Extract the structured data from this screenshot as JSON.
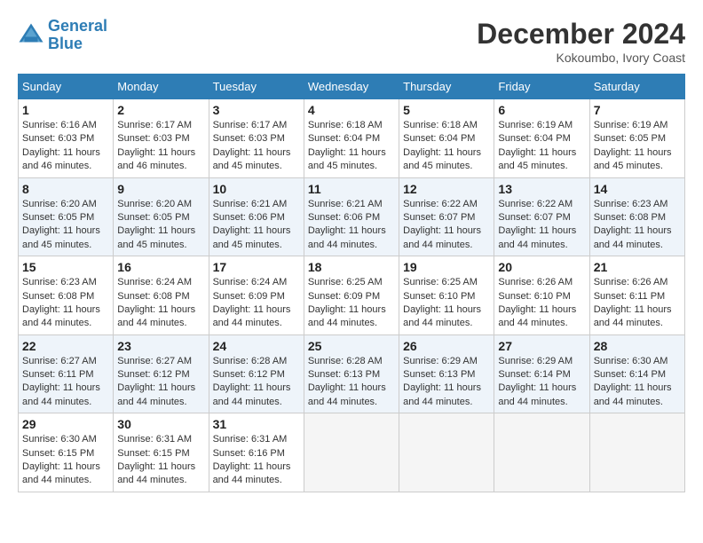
{
  "header": {
    "logo_line1": "General",
    "logo_line2": "Blue",
    "month_title": "December 2024",
    "location": "Kokoumbo, Ivory Coast"
  },
  "weekdays": [
    "Sunday",
    "Monday",
    "Tuesday",
    "Wednesday",
    "Thursday",
    "Friday",
    "Saturday"
  ],
  "weeks": [
    [
      {
        "day": "1",
        "sunrise": "6:16 AM",
        "sunset": "6:03 PM",
        "daylight": "11 hours and 46 minutes."
      },
      {
        "day": "2",
        "sunrise": "6:17 AM",
        "sunset": "6:03 PM",
        "daylight": "11 hours and 46 minutes."
      },
      {
        "day": "3",
        "sunrise": "6:17 AM",
        "sunset": "6:03 PM",
        "daylight": "11 hours and 45 minutes."
      },
      {
        "day": "4",
        "sunrise": "6:18 AM",
        "sunset": "6:04 PM",
        "daylight": "11 hours and 45 minutes."
      },
      {
        "day": "5",
        "sunrise": "6:18 AM",
        "sunset": "6:04 PM",
        "daylight": "11 hours and 45 minutes."
      },
      {
        "day": "6",
        "sunrise": "6:19 AM",
        "sunset": "6:04 PM",
        "daylight": "11 hours and 45 minutes."
      },
      {
        "day": "7",
        "sunrise": "6:19 AM",
        "sunset": "6:05 PM",
        "daylight": "11 hours and 45 minutes."
      }
    ],
    [
      {
        "day": "8",
        "sunrise": "6:20 AM",
        "sunset": "6:05 PM",
        "daylight": "11 hours and 45 minutes."
      },
      {
        "day": "9",
        "sunrise": "6:20 AM",
        "sunset": "6:05 PM",
        "daylight": "11 hours and 45 minutes."
      },
      {
        "day": "10",
        "sunrise": "6:21 AM",
        "sunset": "6:06 PM",
        "daylight": "11 hours and 45 minutes."
      },
      {
        "day": "11",
        "sunrise": "6:21 AM",
        "sunset": "6:06 PM",
        "daylight": "11 hours and 44 minutes."
      },
      {
        "day": "12",
        "sunrise": "6:22 AM",
        "sunset": "6:07 PM",
        "daylight": "11 hours and 44 minutes."
      },
      {
        "day": "13",
        "sunrise": "6:22 AM",
        "sunset": "6:07 PM",
        "daylight": "11 hours and 44 minutes."
      },
      {
        "day": "14",
        "sunrise": "6:23 AM",
        "sunset": "6:08 PM",
        "daylight": "11 hours and 44 minutes."
      }
    ],
    [
      {
        "day": "15",
        "sunrise": "6:23 AM",
        "sunset": "6:08 PM",
        "daylight": "11 hours and 44 minutes."
      },
      {
        "day": "16",
        "sunrise": "6:24 AM",
        "sunset": "6:08 PM",
        "daylight": "11 hours and 44 minutes."
      },
      {
        "day": "17",
        "sunrise": "6:24 AM",
        "sunset": "6:09 PM",
        "daylight": "11 hours and 44 minutes."
      },
      {
        "day": "18",
        "sunrise": "6:25 AM",
        "sunset": "6:09 PM",
        "daylight": "11 hours and 44 minutes."
      },
      {
        "day": "19",
        "sunrise": "6:25 AM",
        "sunset": "6:10 PM",
        "daylight": "11 hours and 44 minutes."
      },
      {
        "day": "20",
        "sunrise": "6:26 AM",
        "sunset": "6:10 PM",
        "daylight": "11 hours and 44 minutes."
      },
      {
        "day": "21",
        "sunrise": "6:26 AM",
        "sunset": "6:11 PM",
        "daylight": "11 hours and 44 minutes."
      }
    ],
    [
      {
        "day": "22",
        "sunrise": "6:27 AM",
        "sunset": "6:11 PM",
        "daylight": "11 hours and 44 minutes."
      },
      {
        "day": "23",
        "sunrise": "6:27 AM",
        "sunset": "6:12 PM",
        "daylight": "11 hours and 44 minutes."
      },
      {
        "day": "24",
        "sunrise": "6:28 AM",
        "sunset": "6:12 PM",
        "daylight": "11 hours and 44 minutes."
      },
      {
        "day": "25",
        "sunrise": "6:28 AM",
        "sunset": "6:13 PM",
        "daylight": "11 hours and 44 minutes."
      },
      {
        "day": "26",
        "sunrise": "6:29 AM",
        "sunset": "6:13 PM",
        "daylight": "11 hours and 44 minutes."
      },
      {
        "day": "27",
        "sunrise": "6:29 AM",
        "sunset": "6:14 PM",
        "daylight": "11 hours and 44 minutes."
      },
      {
        "day": "28",
        "sunrise": "6:30 AM",
        "sunset": "6:14 PM",
        "daylight": "11 hours and 44 minutes."
      }
    ],
    [
      {
        "day": "29",
        "sunrise": "6:30 AM",
        "sunset": "6:15 PM",
        "daylight": "11 hours and 44 minutes."
      },
      {
        "day": "30",
        "sunrise": "6:31 AM",
        "sunset": "6:15 PM",
        "daylight": "11 hours and 44 minutes."
      },
      {
        "day": "31",
        "sunrise": "6:31 AM",
        "sunset": "6:16 PM",
        "daylight": "11 hours and 44 minutes."
      },
      null,
      null,
      null,
      null
    ]
  ]
}
